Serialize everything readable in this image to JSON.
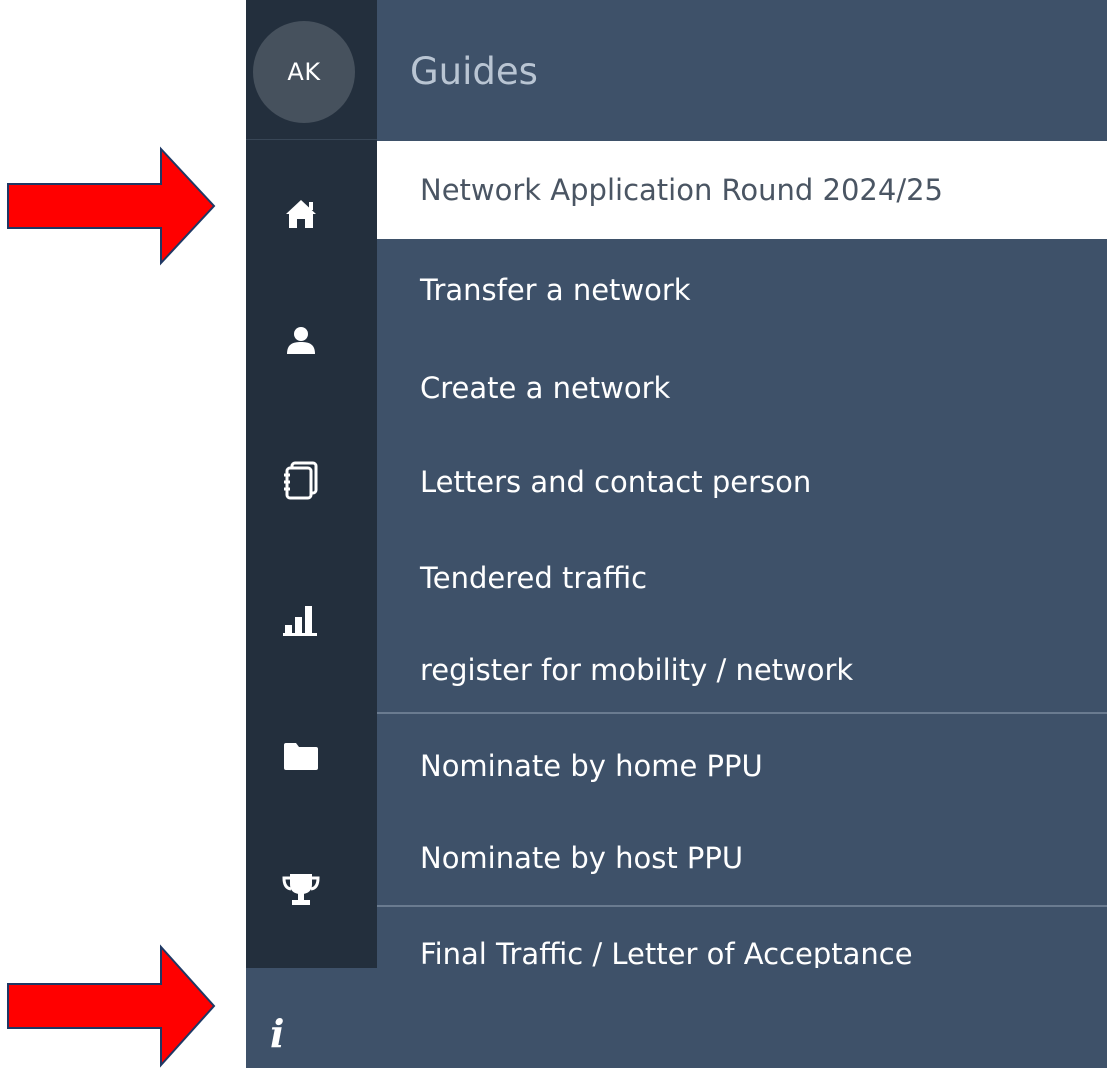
{
  "sidebar": {
    "avatar_initials": "AK",
    "icons": [
      "home-icon",
      "user-icon",
      "notebook-icon",
      "bar-chart-icon",
      "folder-icon",
      "trophy-icon"
    ],
    "info_icon_glyph": "i"
  },
  "panel": {
    "title": "Guides",
    "items": [
      {
        "label": "Network Application Round 2024/25",
        "active": true
      },
      {
        "label": "Transfer a network"
      },
      {
        "label": "Create a network"
      },
      {
        "label": "Letters and contact person"
      },
      {
        "label": "Tendered traffic"
      },
      {
        "label": "register for mobility / network"
      },
      {
        "label": "Nominate by home PPU"
      },
      {
        "label": "Nominate by host PPU"
      },
      {
        "label": "Final Traffic / Letter of Acceptance"
      }
    ]
  },
  "annotations": {
    "arrow_color": "#ff0000"
  },
  "colors": {
    "rail": "#232f3d",
    "panel": "#3e5169",
    "active_item_bg": "#ffffff"
  }
}
